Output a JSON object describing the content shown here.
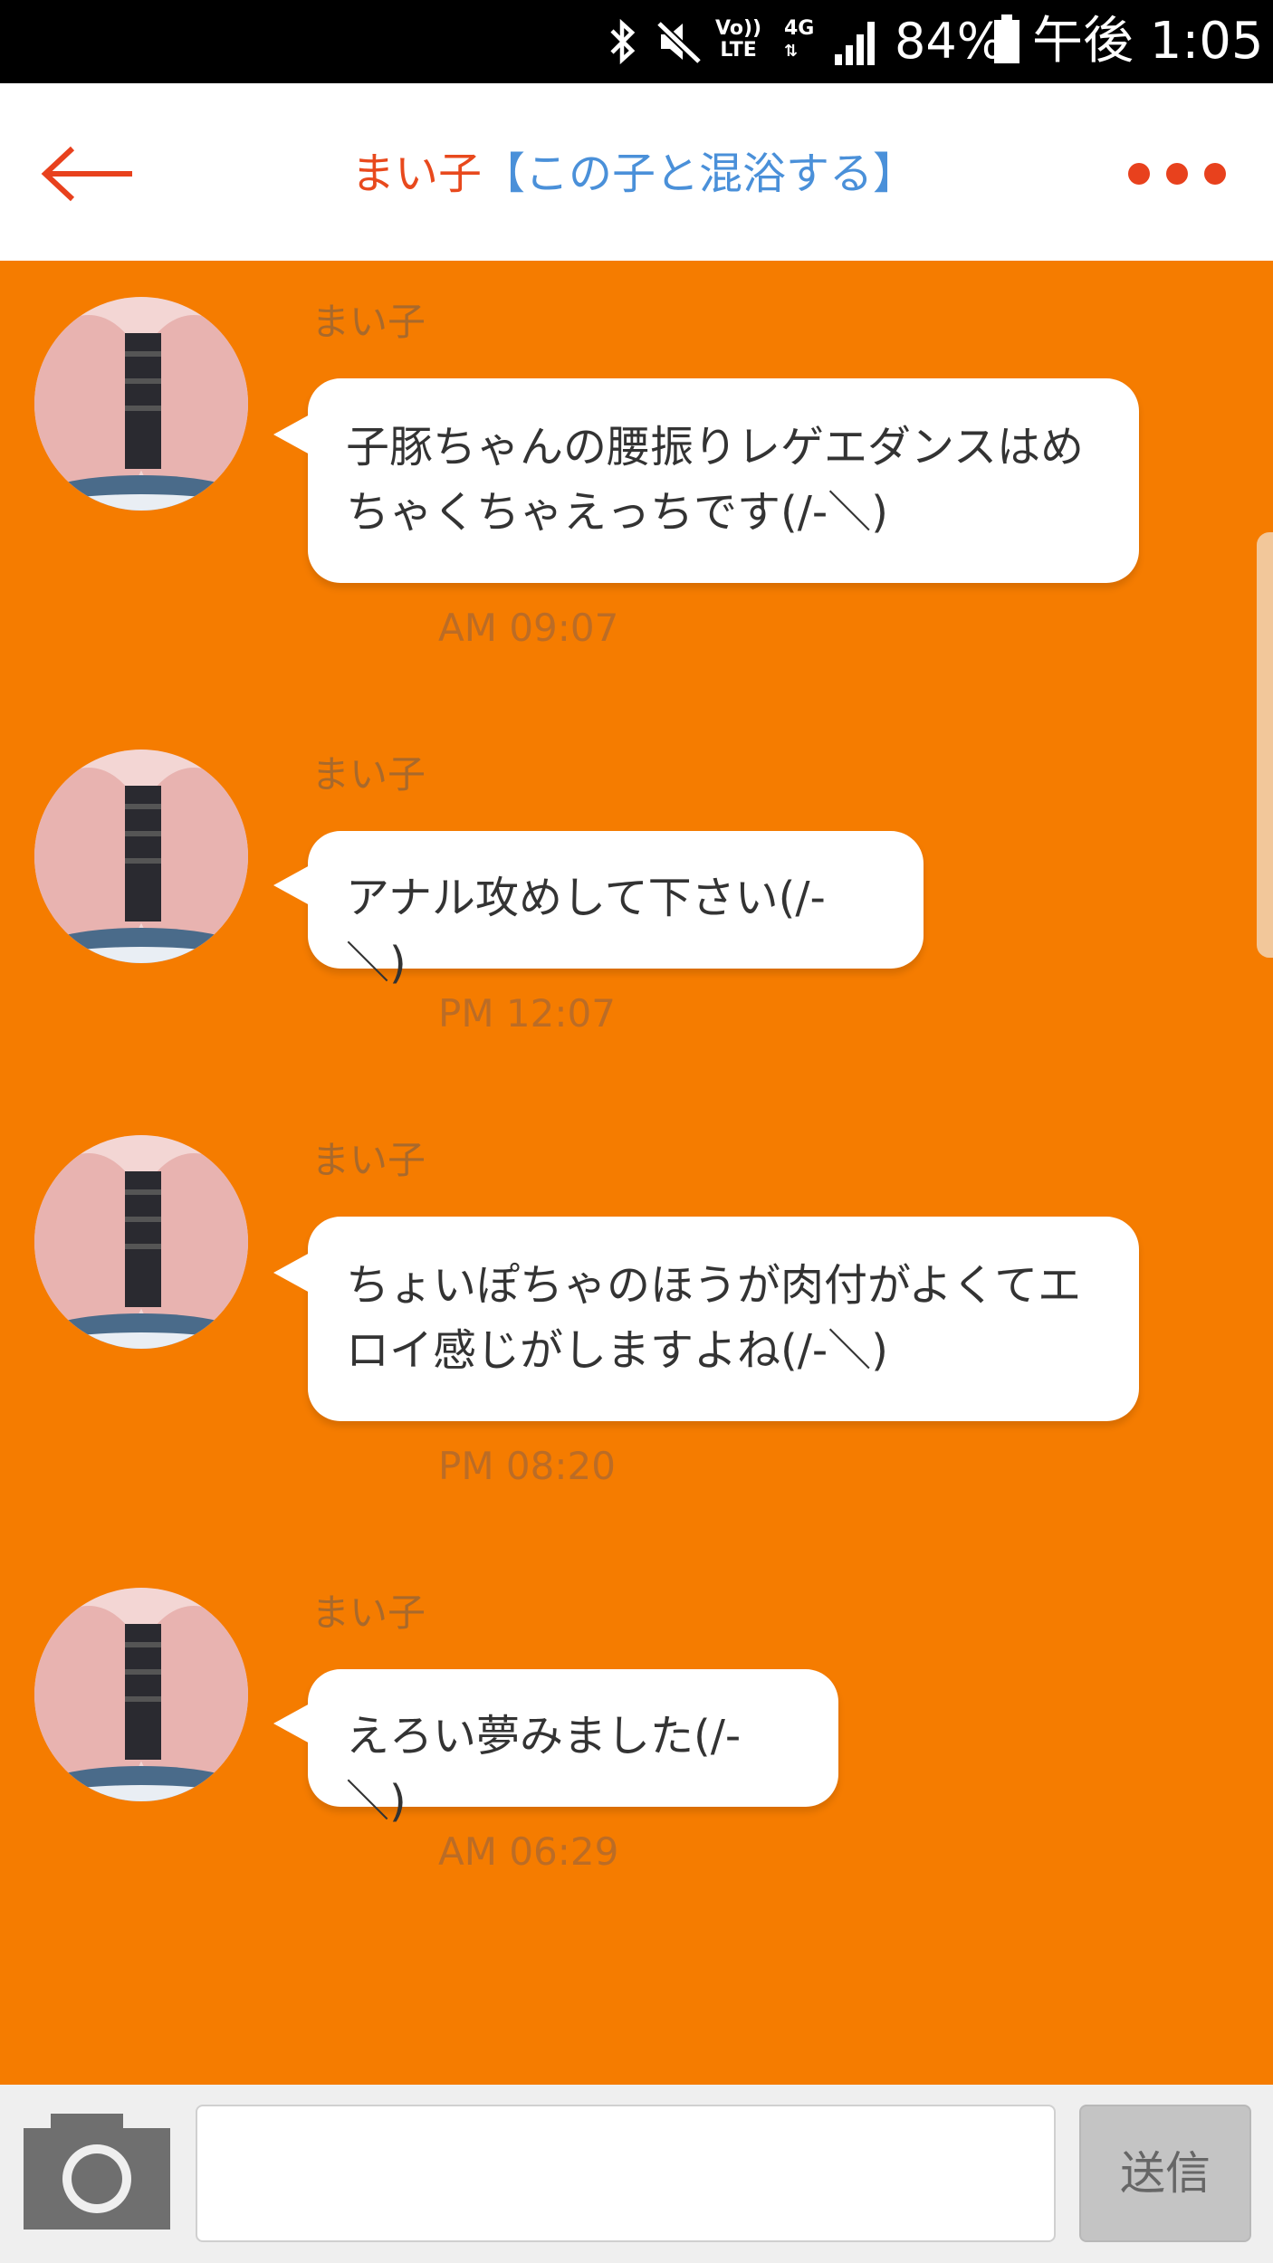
{
  "status_bar": {
    "volte": "Vo))\nLTE",
    "network": "4G",
    "battery": "84%",
    "time": "午後 1:05",
    "icons": [
      "bluetooth-icon",
      "mute-icon",
      "volte-icon",
      "4g-icon",
      "signal-icon",
      "battery-icon"
    ]
  },
  "header": {
    "back_icon": "arrow-left-icon",
    "name": "まい子",
    "action_link": "【この子と混浴する】",
    "more_icon": "more-dots-icon",
    "colors": {
      "name": "#e8491d",
      "link": "#4a90d9",
      "accent": "#e8411d"
    }
  },
  "chat": {
    "background": "#f57c00",
    "messages": [
      {
        "sender": "まい子",
        "text": "子豚ちゃんの腰振りレゲエダンスはめちゃくちゃえっちです(/-＼)",
        "time": "AM 09:07"
      },
      {
        "sender": "まい子",
        "text": "アナル攻めして下さい(/-＼)",
        "time": "PM 12:07"
      },
      {
        "sender": "まい子",
        "text": "ちょいぽちゃのほうが肉付がよくてエロイ感じがしますよね(/-＼)",
        "time": "PM 08:20"
      },
      {
        "sender": "まい子",
        "text": "えろい夢みました(/-＼)",
        "time": "AM 06:29"
      }
    ]
  },
  "compose": {
    "camera_icon": "camera-icon",
    "input_value": "",
    "send_label": "送信"
  }
}
